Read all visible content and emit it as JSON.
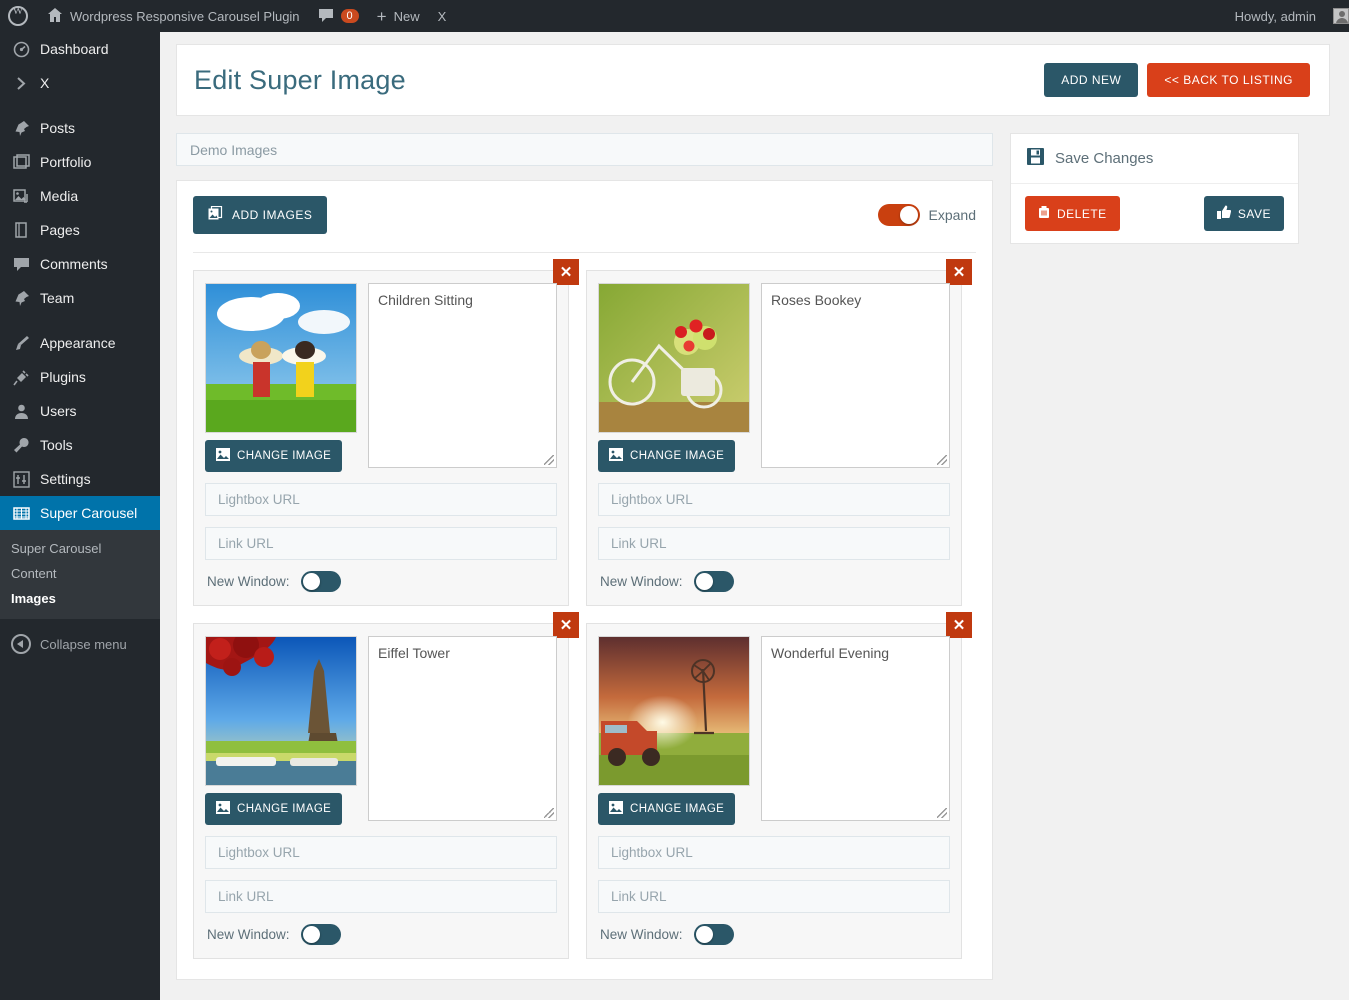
{
  "adminbar": {
    "logo_icon": "wordpress-logo-icon",
    "home_icon": "home-icon",
    "site_title": "Wordpress Responsive Carousel Plugin",
    "comments_icon": "comment-bubble-icon",
    "comment_count": "0",
    "new_icon": "plus-icon",
    "new_label": "New",
    "extra_label": "X",
    "howdy": "Howdy, admin",
    "avatar_icon": "avatar-icon"
  },
  "sidebar": {
    "items": [
      {
        "label": "Dashboard",
        "icon": "dashboard-icon",
        "separator": false
      },
      {
        "label": "X",
        "icon": "chevron-right-icon",
        "separator": false
      },
      {
        "label": "Posts",
        "icon": "pin-icon",
        "separator": true
      },
      {
        "label": "Portfolio",
        "icon": "portfolio-icon",
        "separator": false
      },
      {
        "label": "Media",
        "icon": "media-icon",
        "separator": false
      },
      {
        "label": "Pages",
        "icon": "pages-icon",
        "separator": false
      },
      {
        "label": "Comments",
        "icon": "comment-bubble-icon",
        "separator": false
      },
      {
        "label": "Team",
        "icon": "pin-icon",
        "separator": false
      },
      {
        "label": "Appearance",
        "icon": "brush-icon",
        "separator": true
      },
      {
        "label": "Plugins",
        "icon": "plug-icon",
        "separator": false
      },
      {
        "label": "Users",
        "icon": "user-icon",
        "separator": false
      },
      {
        "label": "Tools",
        "icon": "wrench-icon",
        "separator": false
      },
      {
        "label": "Settings",
        "icon": "sliders-icon",
        "separator": false
      }
    ],
    "active": {
      "label": "Super Carousel",
      "icon": "carousel-icon"
    },
    "submenu": [
      {
        "label": "Super Carousel",
        "current": false
      },
      {
        "label": "Content",
        "current": false
      },
      {
        "label": "Images",
        "current": true
      }
    ],
    "collapse": {
      "label": "Collapse menu",
      "icon": "collapse-arrow-icon"
    },
    "accent_color": "#0073aa",
    "background_color": "#23282d"
  },
  "header": {
    "title": "Edit Super Image",
    "add_new_label": "ADD NEW",
    "back_label": "<< BACK TO LISTING",
    "teal_color": "#2b5768",
    "orange_color": "#d9401a"
  },
  "title_field": {
    "value": "Demo Images",
    "placeholder": "Demo Images"
  },
  "panel": {
    "add_images_label": "ADD IMAGES",
    "add_images_icon": "images-stack-icon",
    "expand_label": "Expand",
    "expand_on": true
  },
  "save_panel": {
    "heading": "Save Changes",
    "heading_icon": "floppy-disk-icon",
    "delete_label": "DELETE",
    "delete_icon": "trash-icon",
    "save_label": "SAVE",
    "save_icon": "thumbs-up-icon"
  },
  "card_labels": {
    "change_image": "CHANGE IMAGE",
    "change_image_icon": "picture-icon",
    "lightbox_placeholder": "Lightbox URL",
    "link_placeholder": "Link URL",
    "new_window_label": "New Window:",
    "close_icon": "close-x-icon"
  },
  "cards": [
    {
      "caption": "Children Sitting",
      "lightbox_url": "",
      "link_url": "",
      "new_window_on": false,
      "thumb": "children-in-field-photo"
    },
    {
      "caption": "Roses Bookey",
      "lightbox_url": "",
      "link_url": "",
      "new_window_on": false,
      "thumb": "bicycle-with-roses-photo"
    },
    {
      "caption": "Eiffel Tower",
      "lightbox_url": "",
      "link_url": "",
      "new_window_on": false,
      "thumb": "eiffel-tower-photo"
    },
    {
      "caption": "Wonderful Evening",
      "lightbox_url": "",
      "link_url": "",
      "new_window_on": false,
      "thumb": "truck-at-sunset-photo"
    }
  ]
}
